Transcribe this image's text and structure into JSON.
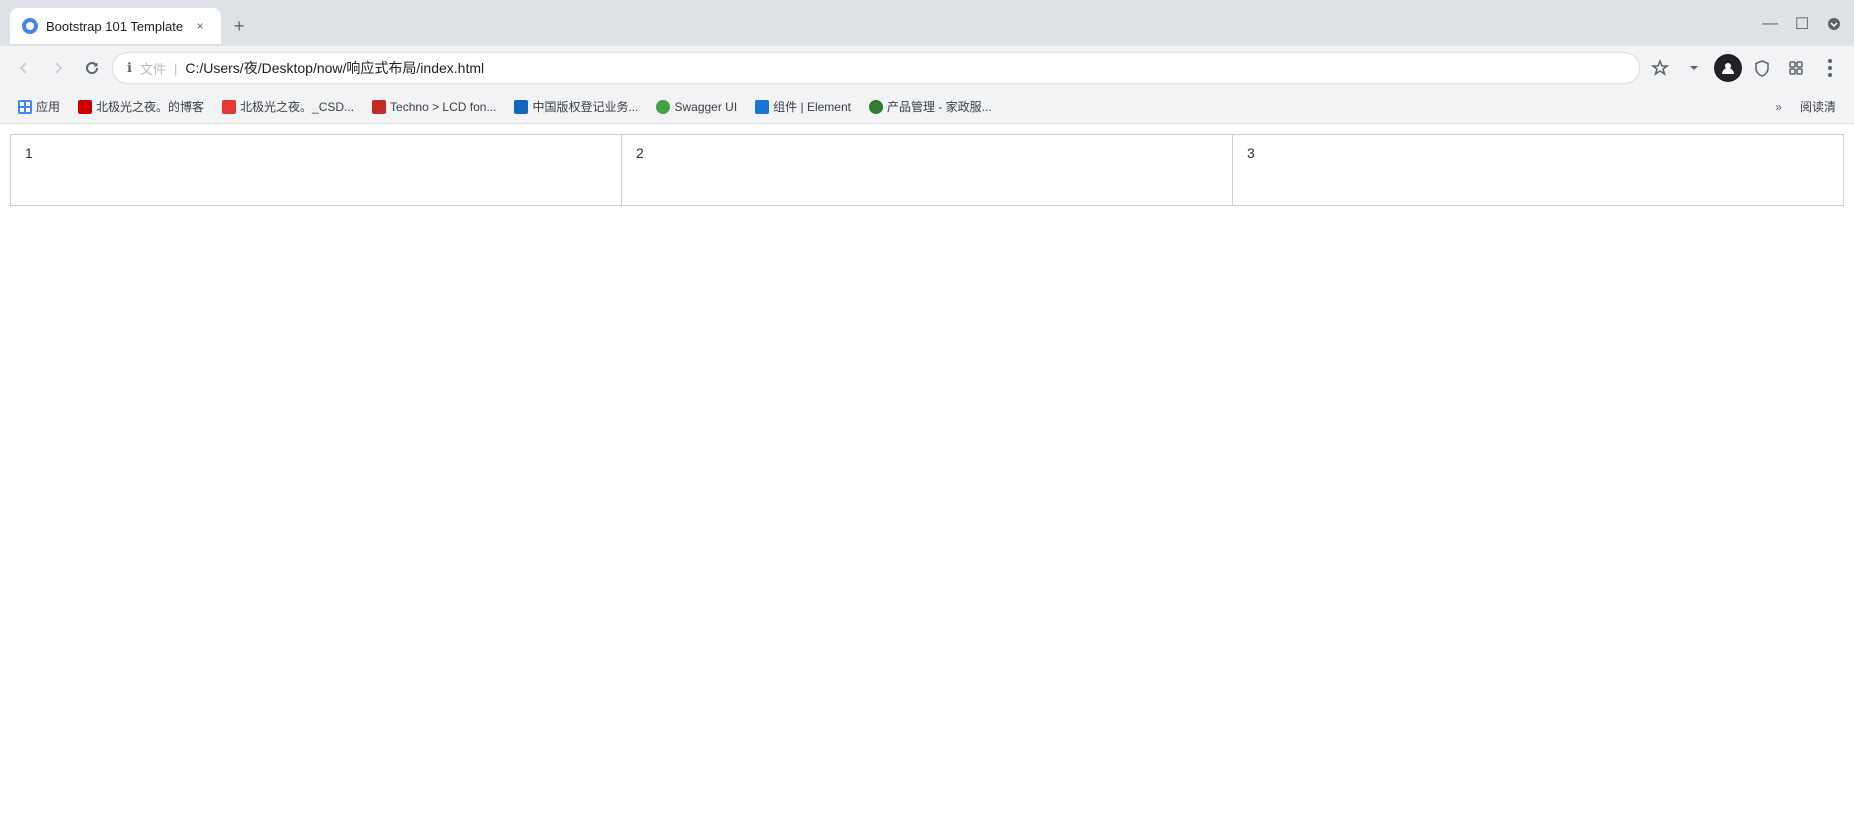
{
  "browser": {
    "tab": {
      "title": "Bootstrap 101 Template",
      "favicon_color": "#4285f4",
      "close_label": "×"
    },
    "new_tab_label": "+",
    "window_controls": {
      "minimize": "—",
      "maximize": "☐",
      "close": ""
    },
    "nav": {
      "back_label": "←",
      "forward_label": "→",
      "refresh_label": "↻",
      "address_type": "文件",
      "address_path": "C:/Users/夜/Desktop/now/响应式布局/index.html",
      "star_label": "☆",
      "profile_label": "👤"
    },
    "bookmarks": [
      {
        "id": "apps",
        "label": "应用",
        "fav_class": "fav-apps",
        "text": "☰"
      },
      {
        "id": "baidu-blog",
        "label": "北极光之夜。的博客",
        "fav_class": "fav-baidu"
      },
      {
        "id": "csdn",
        "label": "北极光之夜。_CSD...",
        "fav_class": "fav-csdn"
      },
      {
        "id": "techno",
        "label": "Techno > LCD fon...",
        "fav_class": "fav-techno"
      },
      {
        "id": "zhongguo",
        "label": "中国版权登记业务...",
        "fav_class": "fav-zhongguo"
      },
      {
        "id": "swagger",
        "label": "Swagger UI",
        "fav_class": "fav-swagger"
      },
      {
        "id": "element",
        "label": "组件 | Element",
        "fav_class": "fav-element"
      },
      {
        "id": "chanpin",
        "label": "产品管理 - 家政服...",
        "fav_class": "fav-chanpin"
      }
    ],
    "more_bookmarks_label": "»",
    "reading_label": "阅读清"
  },
  "page": {
    "cells": [
      {
        "id": "cell-1",
        "label": "1"
      },
      {
        "id": "cell-2",
        "label": "2"
      },
      {
        "id": "cell-3",
        "label": "3"
      }
    ]
  }
}
